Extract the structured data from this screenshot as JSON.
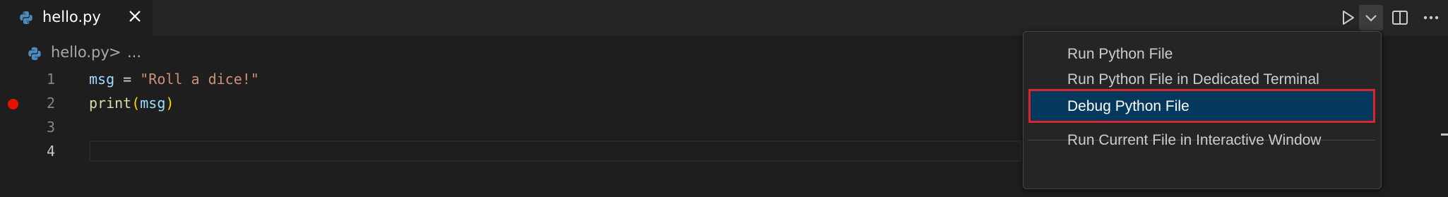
{
  "tab": {
    "filename": "hello.py"
  },
  "breadcrumb": {
    "file": "hello.py",
    "separator": ">",
    "more": "..."
  },
  "editor": {
    "line_numbers": [
      "1",
      "2",
      "3",
      "4"
    ],
    "lines": [
      {
        "tokens": [
          [
            "var",
            "msg"
          ],
          [
            "op",
            " = "
          ],
          [
            "str",
            "\"Roll a dice!\""
          ]
        ]
      },
      {
        "tokens": [
          [
            "fn",
            "print"
          ],
          [
            "paren",
            "("
          ],
          [
            "var",
            "msg"
          ],
          [
            "paren",
            ")"
          ]
        ],
        "breakpoint": true
      },
      {
        "tokens": []
      },
      {
        "tokens": [],
        "current": true
      }
    ]
  },
  "menu": {
    "items": [
      "Run Python File",
      "Run Python File in Dedicated Terminal",
      "Debug Python File",
      "Run Current File in Interactive Window"
    ],
    "selected_index": 2
  },
  "icons": {
    "file": "python-icon",
    "close": "close-icon",
    "run": "play-icon",
    "dropdown": "chevron-down-icon",
    "split": "split-editor-icon",
    "more": "more-actions-icon"
  },
  "colors": {
    "accent_selected": "#04395e",
    "highlight_border": "#d9262b",
    "breakpoint": "#e51400"
  }
}
